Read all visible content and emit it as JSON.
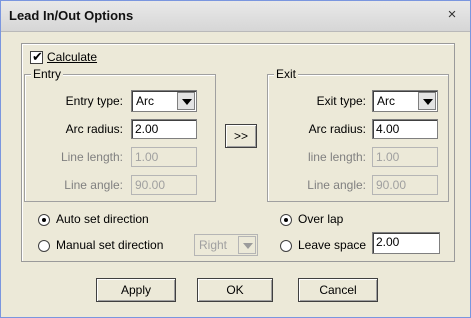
{
  "window": {
    "title": "Lead In/Out Options",
    "close_glyph": "×"
  },
  "calculate": {
    "label": "Calculate",
    "checked": true
  },
  "entry": {
    "legend": "Entry",
    "type_label": "Entry type:",
    "type_value": "Arc",
    "arc_radius_label": "Arc radius:",
    "arc_radius_value": "2.00",
    "line_length_label": "Line length:",
    "line_length_value": "1.00",
    "line_angle_label": "Line angle:",
    "line_angle_value": "90.00"
  },
  "copy_button": {
    "label": ">>"
  },
  "exit": {
    "legend": "Exit",
    "type_label": "Exit type:",
    "type_value": "Arc",
    "arc_radius_label": "Arc radius:",
    "arc_radius_value": "4.00",
    "line_length_label": "line length:",
    "line_length_value": "1.00",
    "line_angle_label": "Line angle:",
    "line_angle_value": "90.00"
  },
  "direction": {
    "auto_label": "Auto set direction",
    "manual_label": "Manual set direction",
    "selected": "auto",
    "direction_value": "Right"
  },
  "overlap": {
    "overlap_label": "Over lap",
    "leave_space_label": "Leave space",
    "leave_space_value": "2.00",
    "selected": "overlap"
  },
  "buttons": {
    "apply": "Apply",
    "ok": "OK",
    "cancel": "Cancel"
  }
}
